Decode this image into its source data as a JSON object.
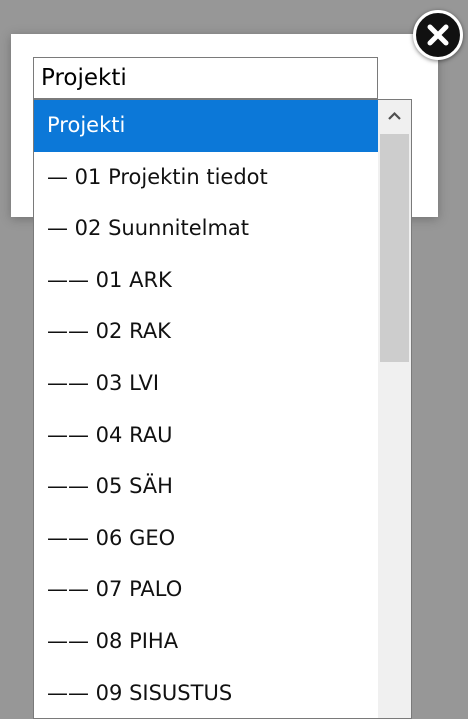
{
  "select": {
    "value": "Projekti"
  },
  "dropdown": {
    "options": [
      {
        "label": "Projekti",
        "selected": true
      },
      {
        "label": "— 01 Projektin tiedot"
      },
      {
        "label": "— 02 Suunnitelmat"
      },
      {
        "label": "—— 01 ARK"
      },
      {
        "label": "—— 02 RAK"
      },
      {
        "label": "—— 03 LVI"
      },
      {
        "label": "—— 04 RAU"
      },
      {
        "label": "—— 05 SÄH"
      },
      {
        "label": "—— 06 GEO"
      },
      {
        "label": "—— 07 PALO"
      },
      {
        "label": "—— 08 PIHA"
      },
      {
        "label": "—— 09 SISUSTUS"
      }
    ]
  },
  "colors": {
    "selected_background": "#0c78d8",
    "backdrop": "#979797"
  },
  "icons": {
    "close": "close-icon",
    "scroll_up": "chevron-up-icon"
  }
}
